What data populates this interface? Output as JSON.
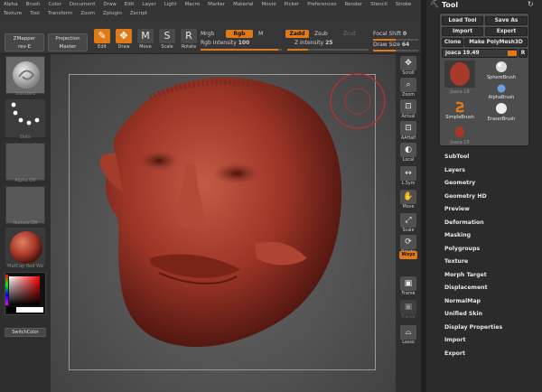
{
  "menu": {
    "row1": [
      "Alpha",
      "Brush",
      "Color",
      "Document",
      "Draw",
      "Edit",
      "Layer",
      "Light",
      "Macro",
      "Marker",
      "Material",
      "Movie",
      "Picker",
      "Preferences",
      "Render",
      "Stencil",
      "Stroke"
    ],
    "row2": [
      "Texture",
      "Tool",
      "Transform",
      "Zoom",
      "Zplugin",
      "Zscript"
    ]
  },
  "shelf": {
    "zmapper": "ZMapper",
    "zmapper_sub": "rev-E",
    "projection": "Projection",
    "projection_sub": "Master",
    "tools": [
      {
        "label": "Edit",
        "icon": "edit-icon",
        "glyph": "✎",
        "active": true
      },
      {
        "label": "Draw",
        "icon": "draw-icon",
        "glyph": "✥",
        "active": true
      },
      {
        "label": "Move",
        "icon": "move-icon",
        "glyph": "M",
        "active": false
      },
      {
        "label": "Scale",
        "icon": "scale-icon",
        "glyph": "S",
        "active": false
      },
      {
        "label": "Rotate",
        "icon": "rotate-icon",
        "glyph": "R",
        "active": false
      }
    ],
    "mrgb": "Mrgb",
    "rgb": "Rgb",
    "m": "M",
    "rgb_intensity_label": "Rgb Intensity",
    "rgb_intensity": "100",
    "zadd": "Zadd",
    "zsub": "Zsub",
    "zcut": "Zcut",
    "z_intensity_label": "Z Intensity",
    "z_intensity": "25",
    "focal_label": "Focal Shift",
    "focal": "0",
    "drawsize_label": "Draw Size",
    "drawsize": "64",
    "rgb_intensity_fraction": 0.95,
    "z_intensity_fraction": 0.25,
    "focal_fraction": 0.5,
    "drawsize_fraction": 0.5
  },
  "left": {
    "brush_label": "Standard",
    "stroke_label": "Dots",
    "alpha_label": "Alpha Off",
    "texture_label": "Texture Off",
    "material_label": "MatCap Red Wa",
    "switch_color": "SwitchColor"
  },
  "right": [
    {
      "label": "Scroll",
      "icon": "scroll-icon",
      "glyph": "✥"
    },
    {
      "label": "Zoom",
      "icon": "zoom-icon",
      "glyph": "⌕"
    },
    {
      "label": "Actual",
      "icon": "actual-icon",
      "glyph": "⊡"
    },
    {
      "label": "AAHalf",
      "icon": "aahalf-icon",
      "glyph": "⊡"
    },
    {
      "label": "Local",
      "icon": "local-icon",
      "glyph": "◐"
    },
    {
      "label": "L.Sym",
      "icon": "lsym-icon",
      "glyph": "↔"
    },
    {
      "label": "Move",
      "icon": "move-view-icon",
      "glyph": "✋"
    },
    {
      "label": "Scale",
      "icon": "scale-view-icon",
      "glyph": "⤢"
    },
    {
      "label": "Rotate",
      "icon": "rotate-view-icon",
      "glyph": "⟳"
    },
    {
      "label": "Frame",
      "icon": "frame-icon",
      "glyph": "▣"
    },
    {
      "label": "Transp",
      "icon": "transp-icon",
      "glyph": "▣"
    },
    {
      "label": "Lasso",
      "icon": "lasso-icon",
      "glyph": "⌓"
    }
  ],
  "xyz": "Wxyz",
  "toolpanel": {
    "title": "Tool",
    "load": "Load Tool",
    "saveas": "Save As",
    "import": "Import",
    "export": "Export",
    "clone": "Clone",
    "make": "Make PolyMesh3D",
    "current": "joaca 19.49",
    "r": "R",
    "thumbs": [
      {
        "label": "joaca 19",
        "icon": "head-thumb-icon"
      },
      {
        "label": "SphereBrush",
        "icon": "sphere-brush-icon"
      },
      {
        "label": "AlphaBrush",
        "icon": "alpha-brush-icon"
      },
      {
        "label": "SimpleBrush",
        "icon": "simple-brush-icon"
      },
      {
        "label": "EraserBrush",
        "icon": "eraser-brush-icon"
      },
      {
        "label": "joaca 19",
        "icon": "head-small-icon"
      }
    ],
    "submenus": [
      "SubTool",
      "Layers",
      "Geometry",
      "Geometry HD",
      "Preview",
      "Deformation",
      "Masking",
      "Polygroups",
      "Texture",
      "Morph Target",
      "Displacement",
      "NormalMap",
      "Unified Skin",
      "Display Properties",
      "Import",
      "Export"
    ]
  },
  "colors": {
    "accent": "#e07a19",
    "head": "#a63a2a"
  }
}
